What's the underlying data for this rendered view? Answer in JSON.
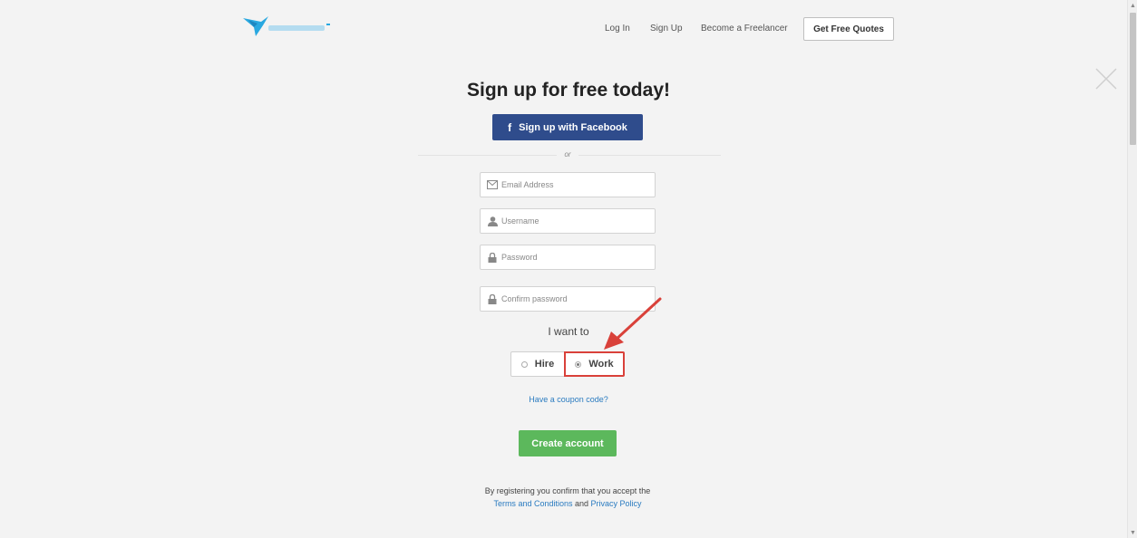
{
  "header": {
    "nav": {
      "login": "Log In",
      "signup": "Sign Up",
      "become_freelancer": "Become a Freelancer",
      "get_quotes": "Get Free Quotes"
    },
    "logo_icon": "freelancer-bird-logo"
  },
  "main": {
    "title": "Sign up for free today!",
    "facebook_button": "Sign up with Facebook",
    "facebook_icon": "f",
    "or_text": "or",
    "fields": {
      "email": {
        "placeholder": "Email Address",
        "value": "",
        "icon": "envelope-icon"
      },
      "username": {
        "placeholder": "Username",
        "value": "",
        "icon": "user-icon"
      },
      "password": {
        "placeholder": "Password",
        "value": "",
        "icon": "lock-icon"
      },
      "confirm_password": {
        "placeholder": "Confirm password",
        "value": "",
        "icon": "lock-icon"
      }
    },
    "want_label": "I want to",
    "options": {
      "hire": {
        "label": "Hire",
        "selected": false
      },
      "work": {
        "label": "Work",
        "selected": true
      }
    },
    "coupon_link": "Have a coupon code?",
    "create_button": "Create account",
    "terms": {
      "line1": "By registering you confirm that you accept the",
      "terms_link": "Terms and Conditions",
      "and_text": "and",
      "privacy_link": "Privacy Policy"
    }
  },
  "colors": {
    "facebook_blue": "#2f4c8c",
    "create_green": "#5cb85c",
    "link_blue": "#2a7bc0",
    "highlight_red": "#d9413a",
    "logo_blue": "#29a8e0"
  }
}
